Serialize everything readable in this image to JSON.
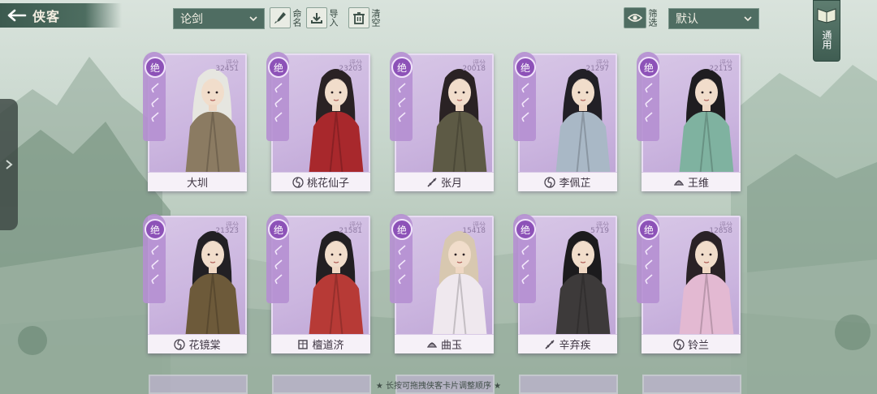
{
  "header": {
    "title": "侠客"
  },
  "filters": {
    "category": "论剑",
    "sort": "默认"
  },
  "toolbar": {
    "rename": "命名",
    "import": "导入",
    "clear": "清空",
    "filter": "筛选"
  },
  "apply_label": "通用",
  "score_caption": "评分",
  "hint": "长按可拖拽侠客卡片调整顺序",
  "rank_glyph": "绝",
  "cards": [
    {
      "name": "大圳",
      "score": "32451",
      "school": "none",
      "hair": "#e6e6e0",
      "robe": "#8b7b62"
    },
    {
      "name": "桃花仙子",
      "score": "23203",
      "school": "swirl",
      "hair": "#2a2224",
      "robe": "#a8282c"
    },
    {
      "name": "张月",
      "score": "20018",
      "school": "blade",
      "hair": "#2a2224",
      "robe": "#5d5a45"
    },
    {
      "name": "李佩芷",
      "score": "21297",
      "school": "swirl",
      "hair": "#222026",
      "robe": "#a9b8c6"
    },
    {
      "name": "王维",
      "score": "22115",
      "school": "fan",
      "hair": "#1f1d20",
      "robe": "#7fb2a0"
    },
    {
      "name": "花镜棠",
      "score": "21323",
      "school": "swirl",
      "hair": "#222024",
      "robe": "#6d5a3a"
    },
    {
      "name": "檀道济",
      "score": "21581",
      "school": "armor",
      "hair": "#221f22",
      "robe": "#b73a36"
    },
    {
      "name": "曲玉",
      "score": "15418",
      "school": "fan",
      "hair": "#d8c8b0",
      "robe": "#efe8ee"
    },
    {
      "name": "辛弃疾",
      "score": "5719",
      "school": "blade",
      "hair": "#1c1b1d",
      "robe": "#3d3a3a"
    },
    {
      "name": "铃兰",
      "score": "12858",
      "school": "swirl",
      "hair": "#2a2226",
      "robe": "#e3b9d2"
    }
  ],
  "colors": {
    "card": "#cbb5df",
    "badge": "#8d52b8",
    "topbar": "#4f6d62"
  }
}
